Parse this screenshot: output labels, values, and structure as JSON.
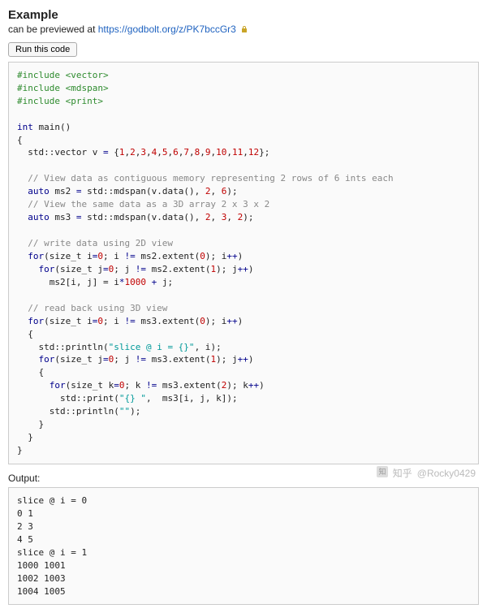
{
  "header": {
    "title": "Example",
    "preview_prefix": "can be previewed at ",
    "preview_url": "https://godbolt.org/z/PK7bccGr3",
    "run_label": "Run this code"
  },
  "code": {
    "inc1": "#include <vector>",
    "inc2": "#include <mdspan>",
    "inc3": "#include <print>",
    "kw_int": "int",
    "main_sig": " main",
    "paren_open": "(",
    "paren_close": ")",
    "brace_open": "{",
    "brace_close": "}",
    "vec_decl_a": "  std",
    "dcolon": "::",
    "vec_decl_b": "vector v ",
    "eq": "=",
    "vec_list_open": " {",
    "n1": "1",
    "n2": "2",
    "n3": "3",
    "n4": "4",
    "n5": "5",
    "n6": "6",
    "n7": "7",
    "n8": "8",
    "n9": "9",
    "n10": "10",
    "n11": "11",
    "n12": "12",
    "comma": ",",
    "vec_list_close": "};",
    "cmt1": "  // View data as contiguous memory representing 2 rows of 6 ints each",
    "kw_auto": "auto",
    "ms2_a": " ms2 ",
    "ms_rhs_a": " std",
    "ms_rhs_b": "mdspan",
    "ms_rhs_c": "v.data",
    "ms_rhs_close": ", ",
    "n2b": "2",
    "n6b": "6",
    "semi": ";",
    "cmt2": "  // View the same data as a 3D array 2 x 3 x 2",
    "ms3_a": " ms3 ",
    "n2c": "2",
    "n3b": "3",
    "n2d": "2",
    "cmt3": "  // write data using 2D view",
    "kw_for": "for",
    "sz_t": "size_t i",
    "sz_tj": "size_t j",
    "sz_tk": "size_t k",
    "zero": "0",
    "one": "1",
    "two": "2",
    "loop1_cond": " i ",
    "neq": "!=",
    "ext0": " ms2.extent",
    "ext0b": " ms3.extent",
    "ipp": " i",
    "jpp": " j",
    "kpp": " k",
    "pp": "++",
    "loop_close": ")",
    "assign_line_a": "      ms2",
    "assign_sub": "[",
    "assign_mid": "i, j",
    "assign_sub2": "]",
    "assign_eq": " = ",
    "thousand": "1000",
    "plusj": " + j",
    "cmt4": "  // read back using 3D view",
    "println_a": "    std",
    "println_b": "println",
    "slice_str": "\"slice @ i = {}\"",
    "print_b": "print",
    "fmt_str": "\"{} \"",
    "ms3_access": "ms3",
    "ijk": "i, j, k",
    "empty_str": "\"\"",
    "ci": ", i",
    "sep2": ",  "
  },
  "output": {
    "label": "Output:",
    "text": "slice @ i = 0\n0 1\n2 3\n4 5\nslice @ i = 1\n1000 1001\n1002 1003\n1004 1005"
  },
  "watermark": {
    "site": "知乎",
    "user": "@Rocky0429"
  }
}
